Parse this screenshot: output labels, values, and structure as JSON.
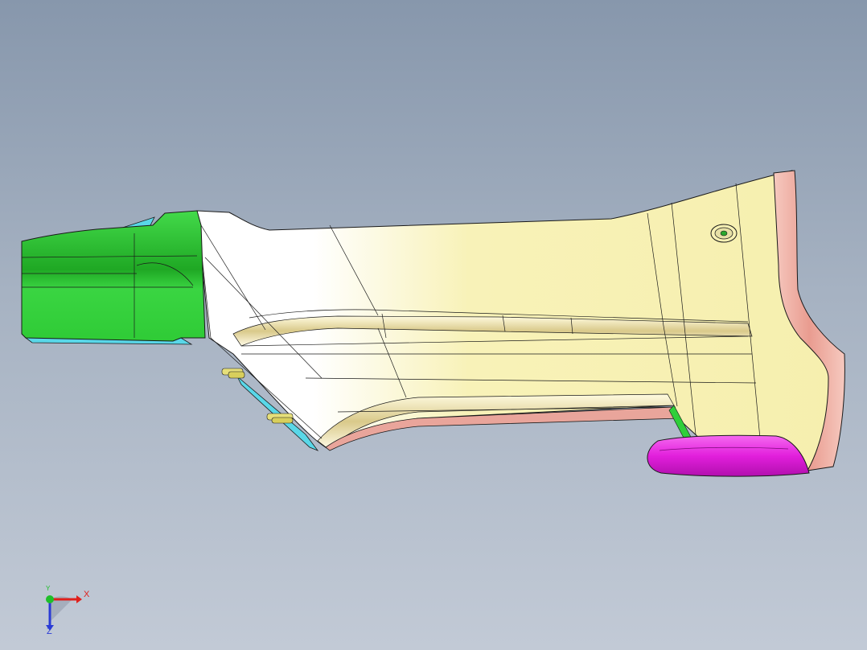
{
  "viewport": {
    "colors": {
      "background_top": "#8797ac",
      "background_bottom": "#c2cad6",
      "body_panel": "#f7f1b4",
      "body_highlight": "#ffffff",
      "green_part": "#2fcf3a",
      "pink_flange": "#f1b1a6",
      "magenta_part": "#ee2ce8",
      "cyan_part": "#59d7e8",
      "clip_yellow": "#e6df7a",
      "edge_line": "#1a1a1a"
    }
  },
  "triad": {
    "x_label": "X",
    "y_label": "Y",
    "z_label": "Z",
    "colors": {
      "x_axis": "#e0201c",
      "y_axis": "#1fbf2a",
      "z_axis": "#2a3bd6"
    }
  }
}
